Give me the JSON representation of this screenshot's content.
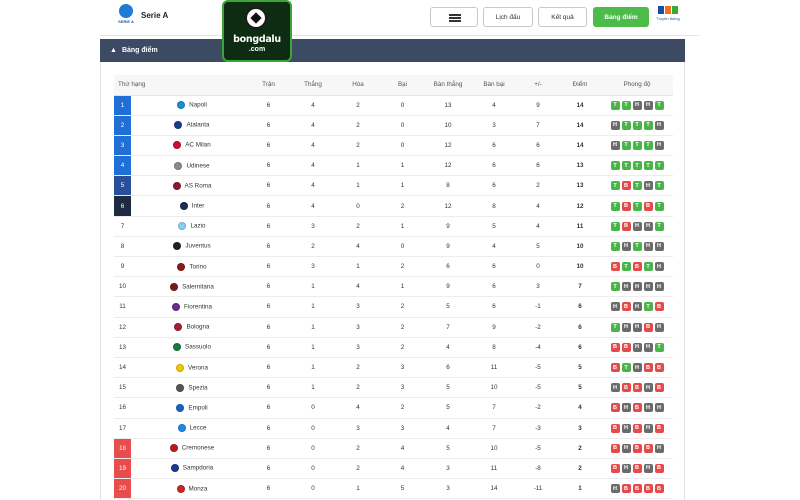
{
  "header": {
    "league_name": "Serie A",
    "league_logo_caption": "SERIE A",
    "brand_name": "bongdalu",
    "brand_suffix": ".com",
    "nav": {
      "schedule": "Lịch đấu",
      "results": "Kết quả",
      "standings": "Bảng điểm"
    },
    "partner_caption": "Truyền thông"
  },
  "panel": {
    "title": "Bảng điểm"
  },
  "columns": {
    "rank_team": "Thứ hạng",
    "played": "Trận",
    "won": "Thắng",
    "drawn": "Hòa",
    "lost": "Bại",
    "goals_for": "Bàn thắng",
    "goals_against": "Bàn bại",
    "diff": "+/-",
    "points": "Điểm",
    "form": "Phong độ"
  },
  "colors": {
    "header_bar": "#3d4a64",
    "win": "#49b549",
    "draw": "#6b6b6b",
    "loss": "#e44a4a",
    "active_nav": "#4cbb4a",
    "zone_cl": "#1f6fd6",
    "zone_el": "#2a4f9a",
    "zone_ecl": "#1d2a3f",
    "zone_relegation": "#e84c4c"
  },
  "rows": [
    {
      "rank": "1",
      "team": "Napoli",
      "played": "6",
      "won": "4",
      "drawn": "2",
      "lost": "0",
      "gf": "13",
      "ga": "4",
      "diff": "9",
      "pts": "14",
      "zone": "cl",
      "crest": "#1a8fd0",
      "form": [
        "T",
        "T",
        "H",
        "H",
        "T"
      ]
    },
    {
      "rank": "2",
      "team": "Atalanta",
      "played": "6",
      "won": "4",
      "drawn": "2",
      "lost": "0",
      "gf": "10",
      "ga": "3",
      "diff": "7",
      "pts": "14",
      "zone": "cl",
      "crest": "#1b3a8c",
      "form": [
        "H",
        "T",
        "T",
        "T",
        "H"
      ]
    },
    {
      "rank": "3",
      "team": "AC Milan",
      "played": "6",
      "won": "4",
      "drawn": "2",
      "lost": "0",
      "gf": "12",
      "ga": "6",
      "diff": "6",
      "pts": "14",
      "zone": "cl",
      "crest": "#c8102e",
      "form": [
        "H",
        "T",
        "T",
        "T",
        "H"
      ]
    },
    {
      "rank": "4",
      "team": "Udinese",
      "played": "6",
      "won": "4",
      "drawn": "1",
      "lost": "1",
      "gf": "12",
      "ga": "6",
      "diff": "6",
      "pts": "13",
      "zone": "cl",
      "crest": "#8a8a8a",
      "form": [
        "T",
        "T",
        "T",
        "T",
        "T"
      ]
    },
    {
      "rank": "5",
      "team": "AS Roma",
      "played": "6",
      "won": "4",
      "drawn": "1",
      "lost": "1",
      "gf": "8",
      "ga": "6",
      "diff": "2",
      "pts": "13",
      "zone": "el",
      "crest": "#8b1a2b",
      "form": [
        "T",
        "B",
        "T",
        "H",
        "T"
      ]
    },
    {
      "rank": "6",
      "team": "Inter",
      "played": "6",
      "won": "4",
      "drawn": "0",
      "lost": "2",
      "gf": "12",
      "ga": "8",
      "diff": "4",
      "pts": "12",
      "zone": "ecl",
      "crest": "#1f2a55",
      "form": [
        "T",
        "B",
        "T",
        "B",
        "T"
      ]
    },
    {
      "rank": "7",
      "team": "Lazio",
      "played": "6",
      "won": "3",
      "drawn": "2",
      "lost": "1",
      "gf": "9",
      "ga": "5",
      "diff": "4",
      "pts": "11",
      "zone": "",
      "crest": "#87ceeb",
      "form": [
        "T",
        "B",
        "H",
        "H",
        "T"
      ]
    },
    {
      "rank": "8",
      "team": "Juventus",
      "played": "6",
      "won": "2",
      "drawn": "4",
      "lost": "0",
      "gf": "9",
      "ga": "4",
      "diff": "5",
      "pts": "10",
      "zone": "",
      "crest": "#222222",
      "form": [
        "T",
        "H",
        "T",
        "H",
        "H"
      ]
    },
    {
      "rank": "9",
      "team": "Torino",
      "played": "6",
      "won": "3",
      "drawn": "1",
      "lost": "2",
      "gf": "6",
      "ga": "6",
      "diff": "0",
      "pts": "10",
      "zone": "",
      "crest": "#8b1a1a",
      "form": [
        "B",
        "T",
        "B",
        "T",
        "H"
      ]
    },
    {
      "rank": "10",
      "team": "Salernitana",
      "played": "6",
      "won": "1",
      "drawn": "4",
      "lost": "1",
      "gf": "9",
      "ga": "6",
      "diff": "3",
      "pts": "7",
      "zone": "",
      "crest": "#7a1b1b",
      "form": [
        "T",
        "H",
        "H",
        "H",
        "H"
      ]
    },
    {
      "rank": "11",
      "team": "Fiorentina",
      "played": "6",
      "won": "1",
      "drawn": "3",
      "lost": "2",
      "gf": "5",
      "ga": "6",
      "diff": "-1",
      "pts": "6",
      "zone": "",
      "crest": "#6a2c8e",
      "form": [
        "H",
        "B",
        "H",
        "T",
        "B"
      ]
    },
    {
      "rank": "12",
      "team": "Bologna",
      "played": "6",
      "won": "1",
      "drawn": "3",
      "lost": "2",
      "gf": "7",
      "ga": "9",
      "diff": "-2",
      "pts": "6",
      "zone": "",
      "crest": "#a31f34",
      "form": [
        "T",
        "H",
        "H",
        "B",
        "H"
      ]
    },
    {
      "rank": "13",
      "team": "Sassuolo",
      "played": "6",
      "won": "1",
      "drawn": "3",
      "lost": "2",
      "gf": "4",
      "ga": "8",
      "diff": "-4",
      "pts": "6",
      "zone": "",
      "crest": "#1a7a3a",
      "form": [
        "B",
        "B",
        "H",
        "H",
        "T"
      ]
    },
    {
      "rank": "14",
      "team": "Verona",
      "played": "6",
      "won": "1",
      "drawn": "2",
      "lost": "3",
      "gf": "6",
      "ga": "11",
      "diff": "-5",
      "pts": "5",
      "zone": "",
      "crest": "#f2c500",
      "form": [
        "B",
        "T",
        "H",
        "B",
        "B"
      ]
    },
    {
      "rank": "15",
      "team": "Spezia",
      "played": "6",
      "won": "1",
      "drawn": "2",
      "lost": "3",
      "gf": "5",
      "ga": "10",
      "diff": "-5",
      "pts": "5",
      "zone": "",
      "crest": "#555555",
      "form": [
        "H",
        "B",
        "B",
        "H",
        "B"
      ]
    },
    {
      "rank": "16",
      "team": "Empoli",
      "played": "6",
      "won": "0",
      "drawn": "4",
      "lost": "2",
      "gf": "5",
      "ga": "7",
      "diff": "-2",
      "pts": "4",
      "zone": "",
      "crest": "#1565c0",
      "form": [
        "B",
        "H",
        "B",
        "H",
        "H"
      ]
    },
    {
      "rank": "17",
      "team": "Lecce",
      "played": "6",
      "won": "0",
      "drawn": "3",
      "lost": "3",
      "gf": "4",
      "ga": "7",
      "diff": "-3",
      "pts": "3",
      "zone": "",
      "crest": "#1e88e5",
      "form": [
        "B",
        "H",
        "B",
        "H",
        "B"
      ]
    },
    {
      "rank": "18",
      "team": "Cremonese",
      "played": "6",
      "won": "0",
      "drawn": "2",
      "lost": "4",
      "gf": "5",
      "ga": "10",
      "diff": "-5",
      "pts": "2",
      "zone": "rel",
      "crest": "#b71c1c",
      "form": [
        "B",
        "H",
        "B",
        "B",
        "H"
      ]
    },
    {
      "rank": "19",
      "team": "Sampdoria",
      "played": "6",
      "won": "0",
      "drawn": "2",
      "lost": "4",
      "gf": "3",
      "ga": "11",
      "diff": "-8",
      "pts": "2",
      "zone": "rel",
      "crest": "#1a3a8c",
      "form": [
        "B",
        "H",
        "B",
        "H",
        "B"
      ]
    },
    {
      "rank": "20",
      "team": "Monza",
      "played": "6",
      "won": "0",
      "drawn": "1",
      "lost": "5",
      "gf": "3",
      "ga": "14",
      "diff": "-11",
      "pts": "1",
      "zone": "rel",
      "crest": "#c62828",
      "form": [
        "H",
        "B",
        "B",
        "B",
        "B"
      ]
    }
  ]
}
